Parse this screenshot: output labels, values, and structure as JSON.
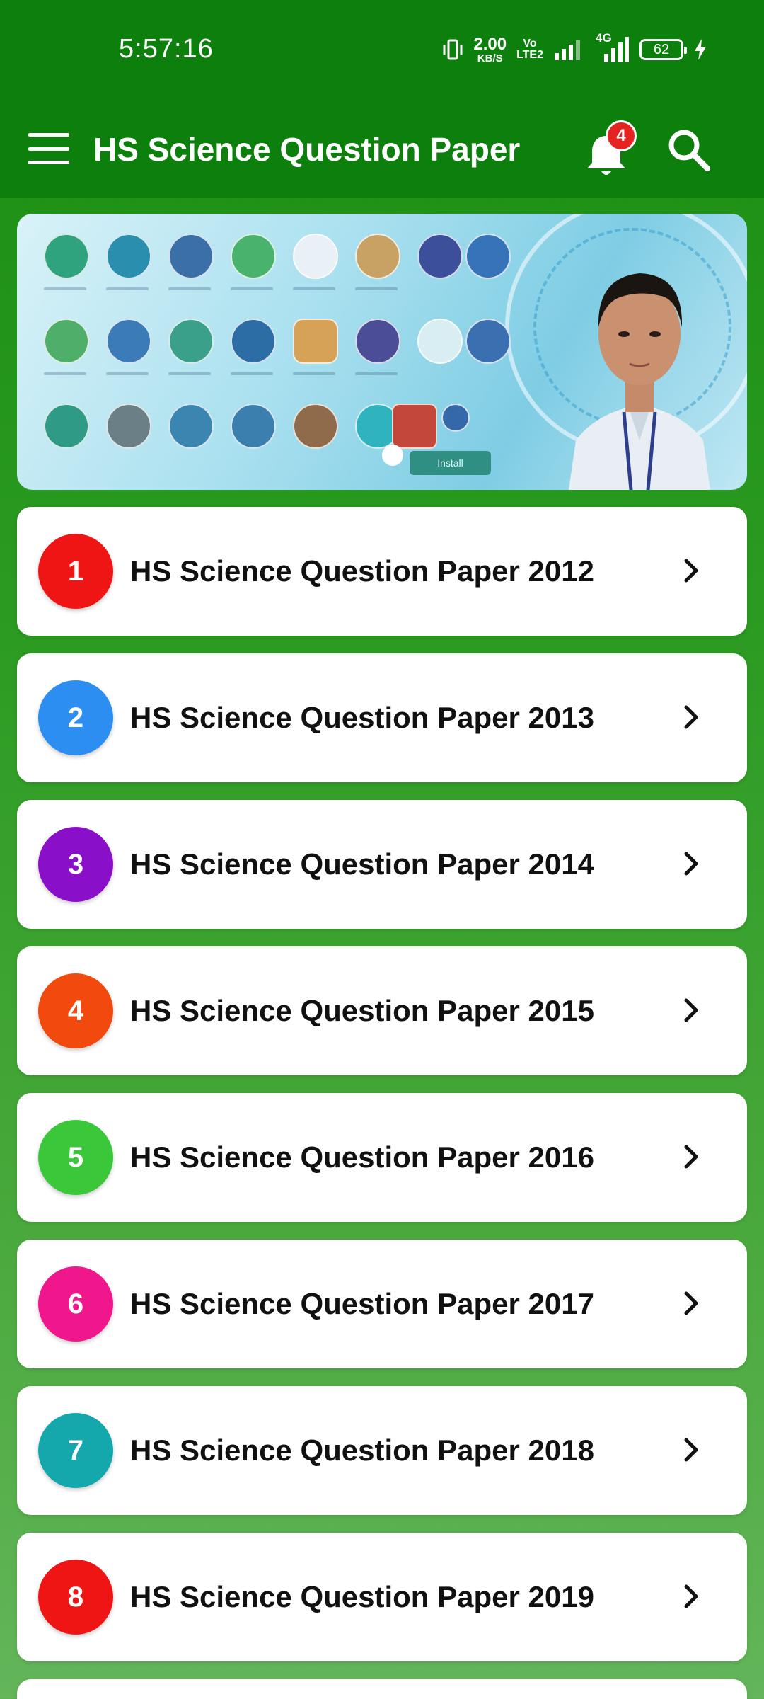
{
  "status_bar": {
    "time": "5:57:16",
    "net_speed_value": "2.00",
    "net_speed_unit": "KB/S",
    "volte_top": "Vo",
    "volte_bottom": "LTE2",
    "network_label": "4G",
    "battery": "62"
  },
  "app_bar": {
    "title": "HS Science Question Paper",
    "notification_count": "4",
    "menu_icon": "hamburger-menu-icon",
    "bell_icon": "bell-icon",
    "search_icon": "search-icon",
    "background_color": "#0d7f0d"
  },
  "banner": {
    "install_label": "Install"
  },
  "list": {
    "items": [
      {
        "number": "1",
        "label": "HS Science Question Paper 2012",
        "color": "#f01515"
      },
      {
        "number": "2",
        "label": "HS Science Question Paper 2013",
        "color": "#2b8ef0"
      },
      {
        "number": "3",
        "label": "HS Science Question Paper 2014",
        "color": "#8a0fc9"
      },
      {
        "number": "4",
        "label": "HS Science Question Paper 2015",
        "color": "#f24a0e"
      },
      {
        "number": "5",
        "label": "HS Science Question Paper 2016",
        "color": "#3ac73a"
      },
      {
        "number": "6",
        "label": "HS Science Question Paper 2017",
        "color": "#f0168c"
      },
      {
        "number": "7",
        "label": "HS Science Question Paper 2018",
        "color": "#14a8ad"
      },
      {
        "number": "8",
        "label": "HS Science Question Paper 2019",
        "color": "#f01515"
      }
    ],
    "chevron_icon": "chevron-right-icon"
  }
}
